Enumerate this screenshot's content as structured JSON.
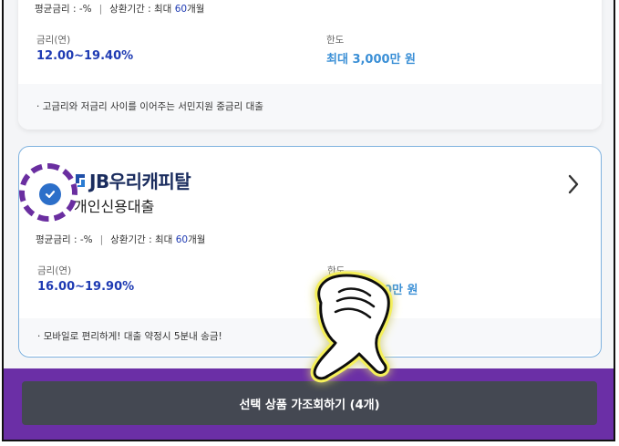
{
  "top_card": {
    "avg_rate_label": "평균금리 : -%",
    "repay_label": "상환기간 : 최대",
    "repay_months": "60",
    "repay_unit": "개월",
    "rate_label": "금리(연)",
    "rate_value": "12.00~19.40%",
    "limit_label": "한도",
    "limit_value": "최대 3,000만 원",
    "note": "고금리와 저금리 사이를 이어주는 서민지원 중금리 대출"
  },
  "selected_card": {
    "brand": "JB우리캐피탈",
    "product": "개인신용대출",
    "avg_rate_label": "평균금리 : -%",
    "repay_label": "상환기간 : 최대",
    "repay_months": "60",
    "repay_unit": "개월",
    "rate_label": "금리(연)",
    "rate_value": "16.00~19.90%",
    "limit_label": "한도",
    "limit_value": "0만 원",
    "note": "모바일로 편리하게! 대출 약정시 5분내 송금!"
  },
  "cta": {
    "label": "선택 상품 가조회하기 (4개)"
  },
  "icons": {
    "check": "check-circle-icon",
    "chevron": "chevron-right-icon",
    "pointer": "pointing-hand-icon",
    "logo": "jb-logo-icon"
  },
  "colors": {
    "rate": "#1f3bb3",
    "limit": "#3a8fd6",
    "selected_border": "#7fb2df",
    "highlight": "#6b2fa6",
    "cta_bg": "#444852"
  }
}
